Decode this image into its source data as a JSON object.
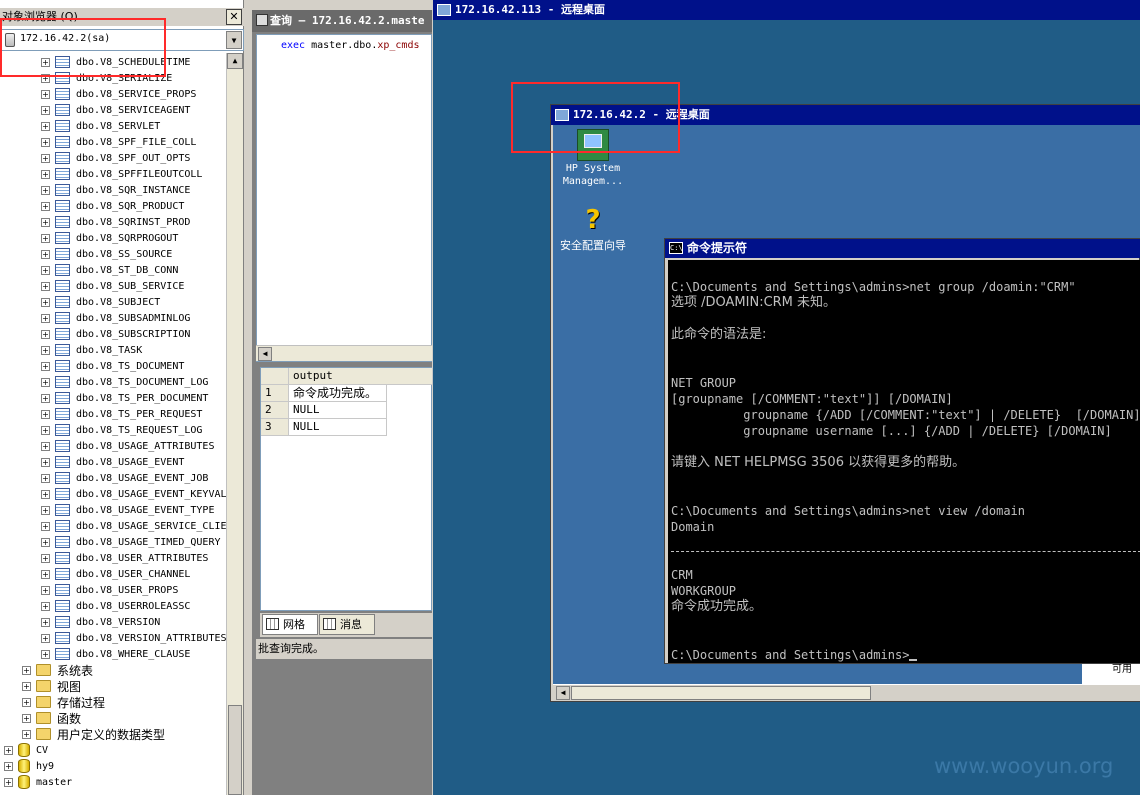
{
  "explorer": {
    "title": "对象浏览器 (Q)",
    "close": "✕",
    "connection": "172.16.42.2(sa)",
    "tables": [
      "dbo.V8_SCHEDULETIME",
      "dbo.V8_SERIALIZE",
      "dbo.V8_SERVICE_PROPS",
      "dbo.V8_SERVICEAGENT",
      "dbo.V8_SERVLET",
      "dbo.V8_SPF_FILE_COLL",
      "dbo.V8_SPF_OUT_OPTS",
      "dbo.V8_SPFFILEOUTCOLL",
      "dbo.V8_SQR_INSTANCE",
      "dbo.V8_SQR_PRODUCT",
      "dbo.V8_SQRINST_PROD",
      "dbo.V8_SQRPROGOUT",
      "dbo.V8_SS_SOURCE",
      "dbo.V8_ST_DB_CONN",
      "dbo.V8_SUB_SERVICE",
      "dbo.V8_SUBJECT",
      "dbo.V8_SUBSADMINLOG",
      "dbo.V8_SUBSCRIPTION",
      "dbo.V8_TASK",
      "dbo.V8_TS_DOCUMENT",
      "dbo.V8_TS_DOCUMENT_LOG",
      "dbo.V8_TS_PER_DOCUMENT",
      "dbo.V8_TS_PER_REQUEST",
      "dbo.V8_TS_REQUEST_LOG",
      "dbo.V8_USAGE_ATTRIBUTES",
      "dbo.V8_USAGE_EVENT",
      "dbo.V8_USAGE_EVENT_JOB",
      "dbo.V8_USAGE_EVENT_KEYVAL",
      "dbo.V8_USAGE_EVENT_TYPE",
      "dbo.V8_USAGE_SERVICE_CLIE",
      "dbo.V8_USAGE_TIMED_QUERY",
      "dbo.V8_USER_ATTRIBUTES",
      "dbo.V8_USER_CHANNEL",
      "dbo.V8_USER_PROPS",
      "dbo.V8_USERROLEASSC",
      "dbo.V8_VERSION",
      "dbo.V8_VERSION_ATTRIBUTES",
      "dbo.V8_WHERE_CLAUSE"
    ],
    "folders": [
      "系统表",
      "视图",
      "存储过程",
      "函数",
      "用户定义的数据类型"
    ],
    "databases": [
      "CV",
      "hy9",
      "master"
    ]
  },
  "query": {
    "tab_title": "查询 — 172.16.42.2.maste",
    "code_exec": "exec ",
    "code_obj": "master.dbo.",
    "code_proc": "xp_cmds",
    "results": {
      "column": "output",
      "rows": [
        {
          "num": "1",
          "value": "命令成功完成。"
        },
        {
          "num": "2",
          "value": "NULL"
        },
        {
          "num": "3",
          "value": "NULL"
        }
      ]
    },
    "tab_grid": "网格",
    "tab_messages": "消息",
    "status": "批查询完成。"
  },
  "rd_outer": {
    "title": "172.16.42.113 - 远程桌面"
  },
  "rd_inner": {
    "title": "172.16.42.2 - 远程桌面",
    "icons": [
      {
        "label1": "HP System",
        "label2": "Managem..."
      },
      {
        "label1": "安全配置向导"
      }
    ],
    "side_text": "可用"
  },
  "cmd": {
    "title": "命令提示符",
    "lines": [
      "C:\\Documents and Settings\\admins>net group /doamin:\"CRM\"",
      "选项 /DOAMIN:CRM 未知。",
      "此命令的语法是:",
      "NET GROUP",
      "[groupname [/COMMENT:\"text\"]] [/DOMAIN]",
      "          groupname {/ADD [/COMMENT:\"text\"] | /DELETE}  [/DOMAIN]",
      "          groupname username [...] {/ADD | /DELETE} [/DOMAIN]",
      "请键入 NET HELPMSG 3506 以获得更多的帮助。",
      "C:\\Documents and Settings\\admins>net view /domain",
      "Domain",
      "CRM",
      "WORKGROUP",
      "命令成功完成。",
      "C:\\Documents and Settings\\admins>"
    ]
  },
  "watermark": "www.wooyun.org",
  "colors": {
    "titlebar": "#00118a",
    "desktop_outer": "#205c86",
    "desktop_inner": "#3a6ea5",
    "highlight_box": "#ff2a2a"
  }
}
